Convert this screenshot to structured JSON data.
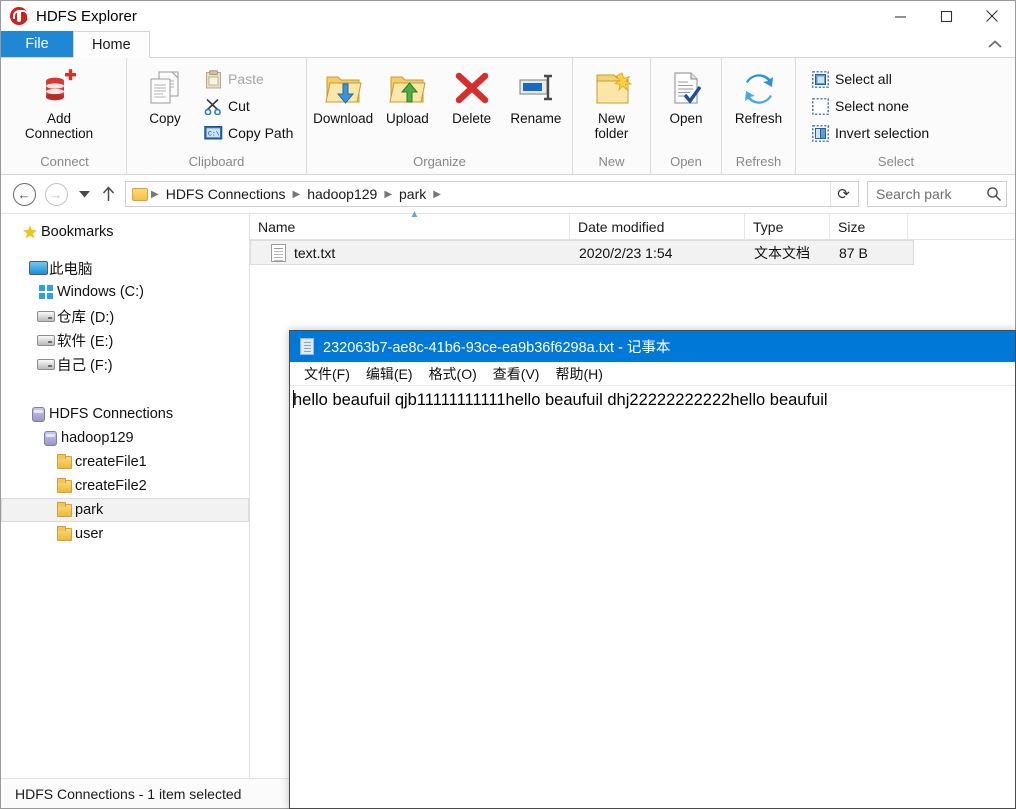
{
  "explorer": {
    "title": "HDFS Explorer",
    "window_buttons": {
      "minimize": "minimize-icon",
      "maximize": "maximize-icon",
      "close": "close-icon",
      "collapse_ribbon": "chevron-up-icon"
    },
    "tabs": [
      {
        "label": "File",
        "active": false
      },
      {
        "label": "Home",
        "active": true
      }
    ],
    "ribbon": {
      "groups": [
        {
          "label": "Connect",
          "buttons": [
            {
              "label": "Add\nConnection",
              "label_line1": "Add",
              "label_line2": "Connection",
              "icon": "database-add-icon"
            }
          ]
        },
        {
          "label": "Clipboard",
          "buttons": [
            {
              "label": "Copy",
              "icon": "copy-icon"
            }
          ],
          "small_buttons": [
            {
              "label": "Paste",
              "icon": "paste-icon",
              "disabled": true
            },
            {
              "label": "Cut",
              "icon": "scissors-icon",
              "disabled": false
            },
            {
              "label": "Copy Path",
              "icon": "copy-path-icon",
              "disabled": false
            }
          ]
        },
        {
          "label": "Organize",
          "buttons": [
            {
              "label": "Download",
              "icon": "folder-download-icon"
            },
            {
              "label": "Upload",
              "icon": "folder-upload-icon"
            },
            {
              "label": "Delete",
              "icon": "red-x-icon"
            },
            {
              "label": "Rename",
              "icon": "rename-icon"
            }
          ]
        },
        {
          "label": "New",
          "buttons": [
            {
              "label": "New folder",
              "label_line1": "New",
              "label_line2": "folder",
              "icon": "new-folder-icon"
            }
          ]
        },
        {
          "label": "Open",
          "buttons": [
            {
              "label": "Open",
              "icon": "open-document-icon"
            }
          ]
        },
        {
          "label": "Refresh",
          "buttons": [
            {
              "label": "Refresh",
              "icon": "refresh-arrows-icon"
            }
          ]
        },
        {
          "label": "Select",
          "small_buttons": [
            {
              "label": "Select all",
              "icon": "select-all-icon"
            },
            {
              "label": "Select none",
              "icon": "select-none-icon"
            },
            {
              "label": "Invert selection",
              "icon": "invert-selection-icon"
            }
          ]
        }
      ]
    },
    "addressbar": {
      "back": "back-arrow-icon",
      "forward": "forward-arrow-icon",
      "recent": "chevron-down-icon",
      "up": "up-arrow-icon",
      "refresh": "refresh-icon",
      "breadcrumbs": [
        "HDFS Connections",
        "hadoop129",
        "park"
      ],
      "search_placeholder": "Search park",
      "search_value": "",
      "search_icon": "search-icon"
    },
    "navpane": {
      "bookmarks_label": "Bookmarks",
      "sections": [
        {
          "root": {
            "label": "此电脑",
            "icon": "this-pc-icon"
          },
          "children": [
            {
              "label": "Windows (C:)",
              "icon": "windows-drive-icon"
            },
            {
              "label": "仓库 (D:)",
              "icon": "drive-icon"
            },
            {
              "label": "软件 (E:)",
              "icon": "drive-icon"
            },
            {
              "label": "自己 (F:)",
              "icon": "drive-icon"
            }
          ]
        },
        {
          "root": {
            "label": "HDFS Connections",
            "icon": "database-icon"
          },
          "children": [
            {
              "label": "hadoop129",
              "icon": "database-icon",
              "level": 1
            },
            {
              "label": "createFile1",
              "icon": "folder-icon",
              "level": 2
            },
            {
              "label": "createFile2",
              "icon": "folder-icon",
              "level": 2
            },
            {
              "label": "park",
              "icon": "folder-icon",
              "level": 2,
              "selected": true
            },
            {
              "label": "user",
              "icon": "folder-icon",
              "level": 2
            }
          ]
        }
      ]
    },
    "filelist": {
      "columns": [
        {
          "label": "Name",
          "sorted": true,
          "sort_dir": "asc"
        },
        {
          "label": "Date modified"
        },
        {
          "label": "Type"
        },
        {
          "label": "Size"
        }
      ],
      "rows": [
        {
          "name": "text.txt",
          "date": "2020/2/23 1:54",
          "type": "文本文档",
          "size": "87 B",
          "icon": "text-file-icon",
          "selected": true
        }
      ]
    },
    "statusbar": {
      "text": "HDFS Connections - 1 item selected"
    }
  },
  "notepad": {
    "title": "232063b7-ae8c-41b6-93ce-ea9b36f6298a.txt - 记事本",
    "icon": "notepad-icon",
    "menu": [
      "文件(F)",
      "编辑(E)",
      "格式(O)",
      "查看(V)",
      "帮助(H)"
    ],
    "content": "hello beaufuil qjb11111111111hello beaufuil dhj22222222222hello beaufuil"
  }
}
